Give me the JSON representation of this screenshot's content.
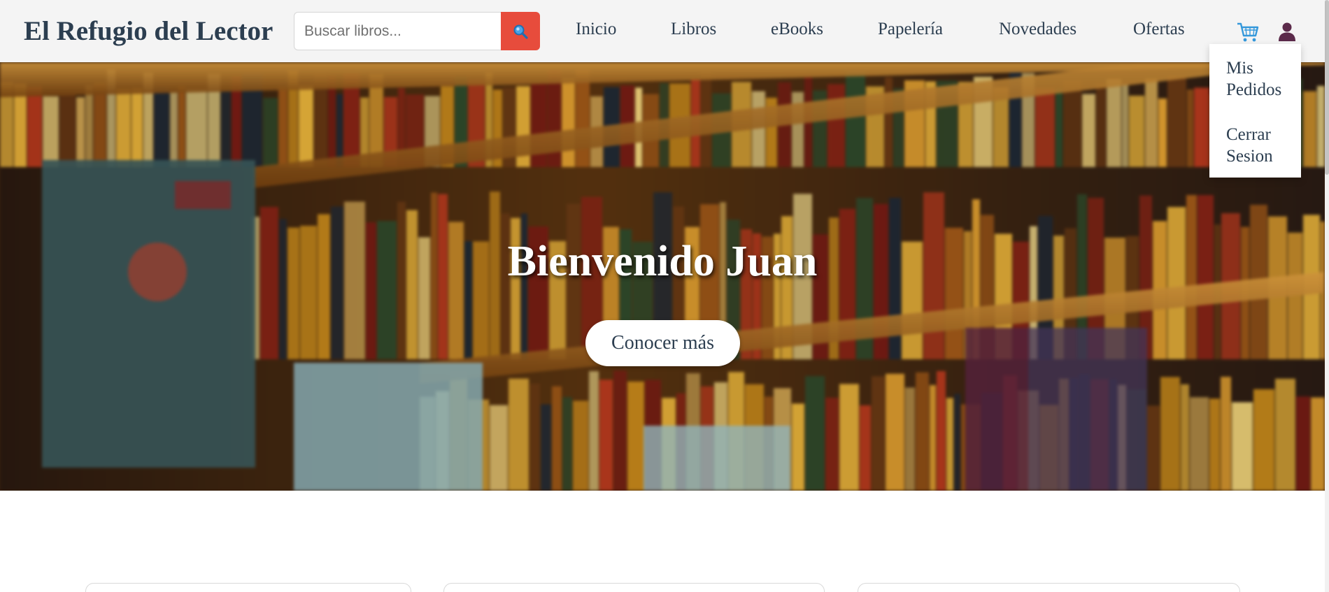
{
  "header": {
    "brand": "El Refugio del Lector",
    "search": {
      "placeholder": "Buscar libros...",
      "value": "",
      "button_icon": "search-icon"
    },
    "nav": [
      "Inicio",
      "Libros",
      "eBooks",
      "Papelería",
      "Novedades",
      "Ofertas"
    ],
    "cart_icon": "cart-icon",
    "user_icon": "user-icon",
    "user_menu": [
      "Mis Pedidos",
      "Cerrar Sesion"
    ]
  },
  "hero": {
    "title": "Bienvenido Juan",
    "button_label": "Conocer más"
  },
  "colors": {
    "brand_text": "#2c3e50",
    "search_button": "#e74c3c",
    "cart_icon": "#3498db",
    "user_icon": "#5b2a4a"
  }
}
